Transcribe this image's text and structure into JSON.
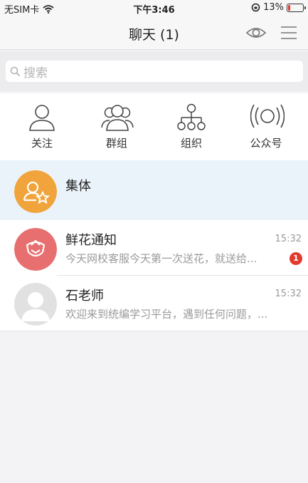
{
  "status_bar": {
    "carrier": "无SIM卡",
    "time": "下午3:46",
    "battery": "13%",
    "battery_level": 0.13
  },
  "nav": {
    "title": "聊天 (1)",
    "eye_icon": "eye-icon",
    "menu_icon": "hamburger-menu-icon"
  },
  "search": {
    "placeholder": "搜索",
    "icon": "search-icon"
  },
  "quick_actions": [
    {
      "label": "关注",
      "icon": "person-icon"
    },
    {
      "label": "群组",
      "icon": "group-icon"
    },
    {
      "label": "组织",
      "icon": "org-chart-icon"
    },
    {
      "label": "公众号",
      "icon": "broadcast-icon"
    }
  ],
  "chats": [
    {
      "name": "集体",
      "avatar_color": "#f0a43b",
      "icon": "group-star-icon"
    },
    {
      "name": "鲜花通知",
      "time": "15:32",
      "preview": "今天网校客服今天第一次送花，就送给...",
      "badge": "1",
      "avatar_color": "#e86f6f",
      "icon": "flower-icon"
    },
    {
      "name": "石老师",
      "time": "15:32",
      "preview": "欢迎来到统编学习平台，遇到任何问题，...",
      "avatar_color": "#e1e1e1",
      "icon": "default-avatar-icon"
    }
  ]
}
